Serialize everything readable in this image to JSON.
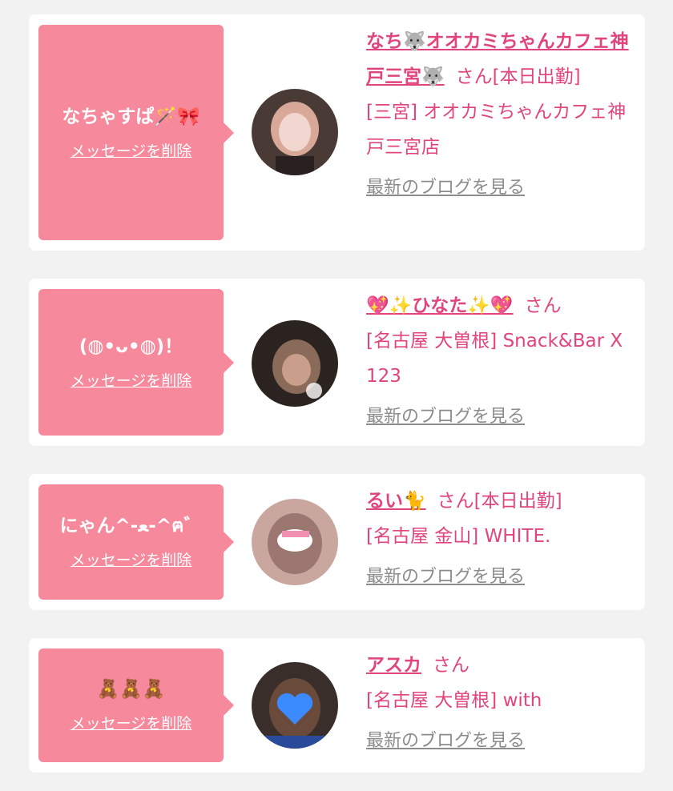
{
  "cards": [
    {
      "message": "なちゃすぱ🪄🎀",
      "delete_label": "メッセージを削除",
      "name": "なち🐺オオカミちゃんカフェ神戸三宮🐺",
      "honorific": "さん",
      "status": "[本日出勤]",
      "shop": "[三宮] オオカミちゃんカフェ神戸三宮店",
      "blog_label": "最新のブログを見る"
    },
    {
      "message": "(◍•ᴗ•◍)！",
      "delete_label": "メッセージを削除",
      "name": "💖✨ひなた✨💖",
      "honorific": "さん",
      "status": "",
      "shop": "[名古屋 大曽根] Snack&Bar X 123",
      "blog_label": "最新のブログを見る"
    },
    {
      "message": "にゃん^-ﻌ-^ฅ゛",
      "delete_label": "メッセージを削除",
      "name": "るい🐈",
      "honorific": "さん",
      "status": "[本日出勤]",
      "shop": "[名古屋 金山] WHITE.",
      "blog_label": "最新のブログを見る"
    },
    {
      "message": "🧸🧸🧸",
      "delete_label": "メッセージを削除",
      "name": "アスカ",
      "honorific": "さん",
      "status": "",
      "shop": "[名古屋 大曽根] with",
      "blog_label": "最新のブログを見る"
    }
  ],
  "colors": {
    "bubble": "#f7899c",
    "accent": "#e0457b",
    "link_gray": "#8c8c8c",
    "background": "#f2f2f2"
  }
}
